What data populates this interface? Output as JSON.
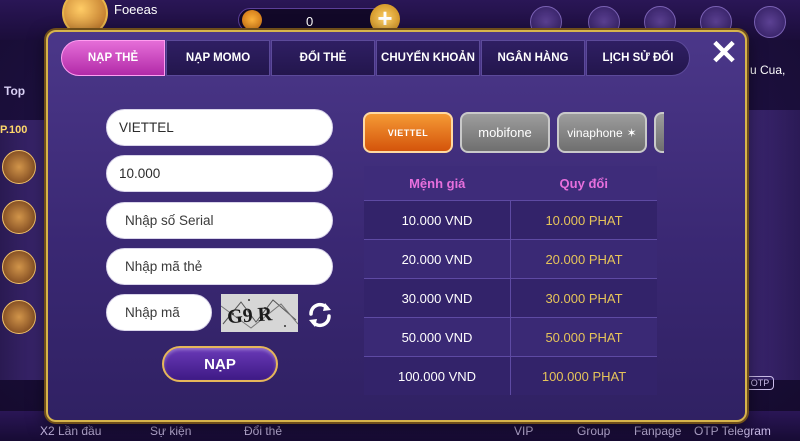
{
  "background": {
    "username": "Foeeas",
    "balance": "0",
    "left_label": "Top",
    "left_tag": "P.100",
    "right_text": "u Cua,",
    "bottom_nav": [
      "X2 Lần đầu",
      "Sự kiện",
      "Đổi thẻ",
      "VIP",
      "Group",
      "Fanpage",
      "OTP Telegram"
    ],
    "otp_tag": "OTP"
  },
  "tabs": [
    {
      "label": "NẠP THẺ",
      "active": true
    },
    {
      "label": "NẠP MOMO",
      "active": false
    },
    {
      "label": "ĐỔI THẺ",
      "active": false
    },
    {
      "label": "CHUYỂN KHOẢN",
      "active": false
    },
    {
      "label": "NGÂN HÀNG",
      "active": false
    },
    {
      "label": "LỊCH SỬ ĐỔI",
      "active": false
    }
  ],
  "close_label": "✕",
  "form": {
    "carrier_value": "VIETTEL",
    "amount_value": "10.000",
    "serial_placeholder": "Nhập số Serial",
    "pin_placeholder": "Nhập mã thẻ",
    "captcha_placeholder": "Nhập mã",
    "captcha_text": "G9 R",
    "submit_label": "NẠP"
  },
  "carriers": [
    {
      "name": "VIETTEL",
      "active": true
    },
    {
      "name": "mobifone",
      "active": false
    },
    {
      "name": "vinaphone",
      "active": false
    }
  ],
  "rate_table": {
    "headers": [
      "Mệnh giá",
      "Quy đổi"
    ],
    "rows": [
      [
        "10.000 VND",
        "10.000 PHAT"
      ],
      [
        "20.000 VND",
        "20.000 PHAT"
      ],
      [
        "30.000 VND",
        "30.000 PHAT"
      ],
      [
        "50.000 VND",
        "50.000 PHAT"
      ],
      [
        "100.000 VND",
        "100.000 PHAT"
      ]
    ]
  },
  "colors": {
    "active_tab": "#c93ebd",
    "accent_gold": "#d7b44c",
    "rate_value": "#e6c45a",
    "header_pink": "#e76fdd"
  }
}
